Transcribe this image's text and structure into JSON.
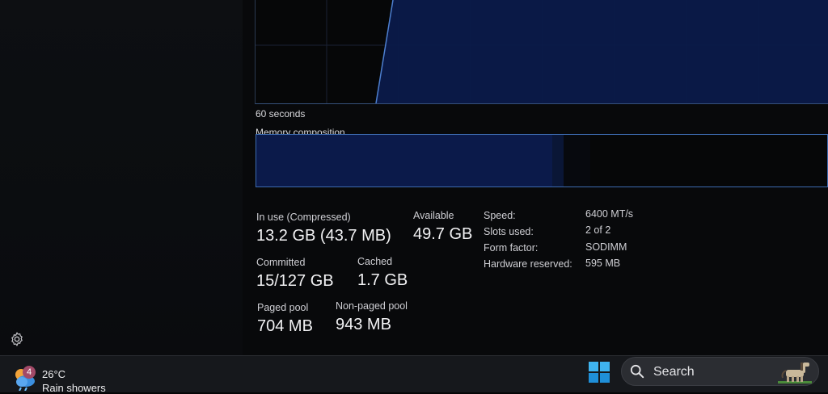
{
  "graph": {
    "time_label": "60 seconds"
  },
  "composition": {
    "title": "Memory composition"
  },
  "stats": {
    "in_use": {
      "label": "In use (Compressed)",
      "value": "13.2 GB (43.7 MB)"
    },
    "available": {
      "label": "Available",
      "value": "49.7 GB"
    },
    "committed": {
      "label": "Committed",
      "value": "15/127 GB"
    },
    "cached": {
      "label": "Cached",
      "value": "1.7 GB"
    },
    "paged_pool": {
      "label": "Paged pool",
      "value": "704 MB"
    },
    "non_paged_pool": {
      "label": "Non-paged pool",
      "value": "943 MB"
    }
  },
  "details": [
    {
      "label": "Speed:",
      "value": "6400 MT/s"
    },
    {
      "label": "Slots used:",
      "value": "2 of 2"
    },
    {
      "label": "Form factor:",
      "value": "SODIMM"
    },
    {
      "label": "Hardware reserved:",
      "value": "595 MB"
    }
  ],
  "taskbar": {
    "weather": {
      "badge": "4",
      "temp": "26°C",
      "condition": "Rain showers",
      "icon": "weather-rain-icon"
    },
    "search_label": "Search"
  },
  "colors": {
    "accent": "#4d7fcf",
    "graph_fill": "#0b1a4a"
  }
}
